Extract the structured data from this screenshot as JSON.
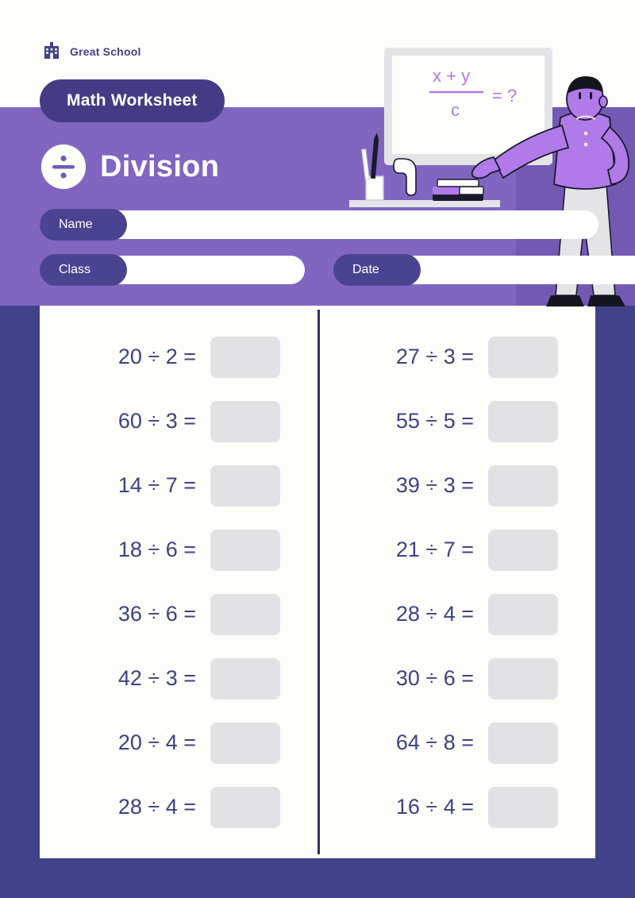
{
  "header": {
    "school_name": "Great School",
    "school_icon": "school-building-icon",
    "badge_label": "Math Worksheet",
    "title": "Division",
    "title_icon": "division-sign-icon"
  },
  "form": {
    "name_label": "Name",
    "name_value": "",
    "class_label": "Class",
    "class_value": "",
    "date_label": "Date",
    "date_value": ""
  },
  "illustration": {
    "whiteboard_numerator": "x + y",
    "whiteboard_denominator": "c",
    "whiteboard_equals": "= ?"
  },
  "colors": {
    "page_background": "#41428a",
    "sheet": "#fdfdfa",
    "band_purple": "#8066c0",
    "band_purple_dark": "#7459b4",
    "badge_navy": "#433c84",
    "pill_navy": "#4a4490",
    "text_navy": "#3d4284",
    "answer_box": "#e2e2e4",
    "divider": "#2f3061",
    "accent_light_purple": "#b07ae8"
  },
  "problems": {
    "left_column": [
      {
        "expr": "20 ÷ 2 =",
        "answer": ""
      },
      {
        "expr": "60 ÷ 3 =",
        "answer": ""
      },
      {
        "expr": "14 ÷ 7 =",
        "answer": ""
      },
      {
        "expr": "18 ÷ 6 =",
        "answer": ""
      },
      {
        "expr": "36 ÷ 6 =",
        "answer": ""
      },
      {
        "expr": "42 ÷ 3 =",
        "answer": ""
      },
      {
        "expr": "20 ÷ 4 =",
        "answer": ""
      },
      {
        "expr": "28 ÷ 4 =",
        "answer": ""
      }
    ],
    "right_column": [
      {
        "expr": "27 ÷ 3 =",
        "answer": ""
      },
      {
        "expr": "55 ÷ 5 =",
        "answer": ""
      },
      {
        "expr": "39 ÷ 3 =",
        "answer": ""
      },
      {
        "expr": "21 ÷ 7 =",
        "answer": ""
      },
      {
        "expr": "28 ÷ 4 =",
        "answer": ""
      },
      {
        "expr": "30 ÷ 6 =",
        "answer": ""
      },
      {
        "expr": "64 ÷ 8 =",
        "answer": ""
      },
      {
        "expr": "16 ÷ 4 =",
        "answer": ""
      }
    ]
  }
}
